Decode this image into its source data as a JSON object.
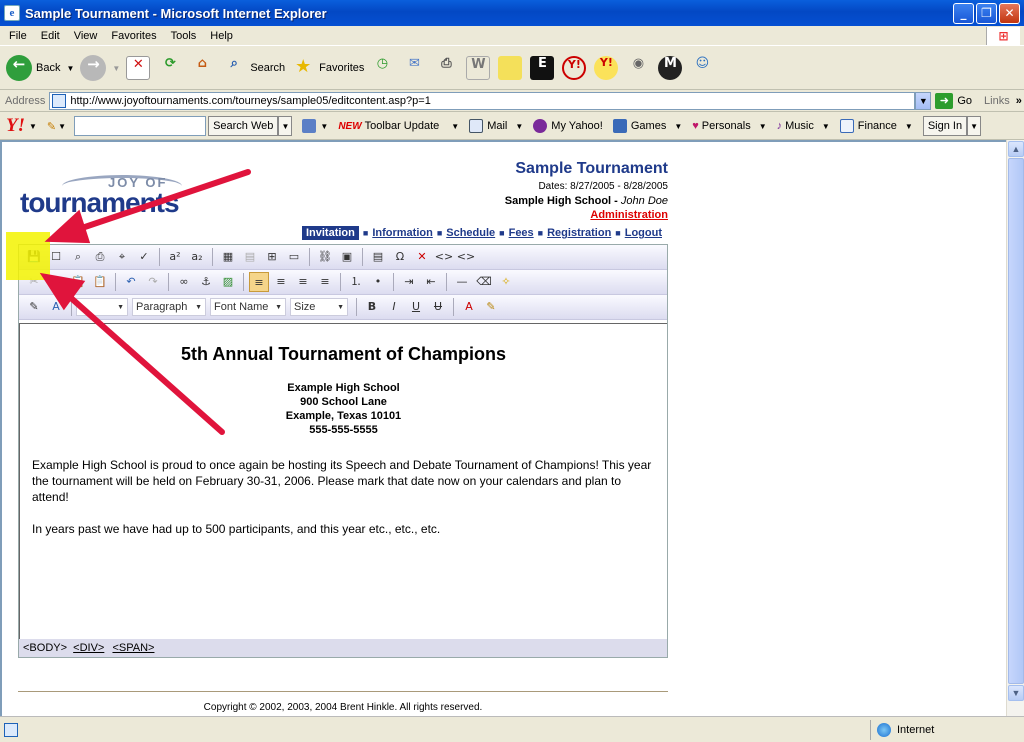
{
  "window": {
    "title": "Sample Tournament - Microsoft Internet Explorer",
    "min": "_",
    "max": "❐",
    "close": "✕"
  },
  "menu": [
    "File",
    "Edit",
    "View",
    "Favorites",
    "Tools",
    "Help"
  ],
  "toolbar": {
    "back": "Back",
    "search": "Search",
    "favorites": "Favorites"
  },
  "address": {
    "label": "Address",
    "url": "http://www.joyoftournaments.com/tourneys/sample05/editcontent.asp?p=1",
    "go": "Go",
    "links": "Links"
  },
  "yahoo": {
    "logo": "Y!",
    "search_button": "Search Web",
    "toolbar_update": "Toolbar Update",
    "new": "NEW",
    "items": [
      "Mail",
      "My Yahoo!",
      "Games",
      "Personals",
      "Music",
      "Finance"
    ],
    "sign_in": "Sign In"
  },
  "logo": {
    "joy": "JOY OF",
    "word": "tournaments"
  },
  "header": {
    "title": "Sample Tournament",
    "dates": "Dates: 8/27/2005 - 8/28/2005",
    "school": "Sample High School -",
    "person": "John Doe",
    "admin": "Administration"
  },
  "nav": [
    "Invitation",
    "Information",
    "Schedule",
    "Fees",
    "Registration",
    "Logout"
  ],
  "editor": {
    "selects": {
      "style": "Paragraph",
      "font": "Font Name",
      "size": "Size"
    },
    "heading": "5th Annual Tournament of Champions",
    "address_lines": [
      "Example High School",
      "900 School Lane",
      "Example, Texas 10101",
      "555-555-5555"
    ],
    "para1": "Example High School is proud to once again be hosting its Speech and Debate Tournament of Champions!  This year the tournament will be held on February 30-31, 2006.  Please mark that date now on your calendars and plan to attend!",
    "para2": "In years past we have had up to 500 participants, and this year etc., etc., etc.",
    "path": [
      "<BODY>",
      "<DIV>",
      "<SPAN>"
    ]
  },
  "footer": "Copyright © 2002, 2003, 2004 Brent Hinkle. All rights reserved.",
  "status": {
    "zone": "Internet"
  },
  "colors": {
    "highlight": "#f3f300",
    "arrow": "#e0143c",
    "brand": "#1f3a8a"
  }
}
